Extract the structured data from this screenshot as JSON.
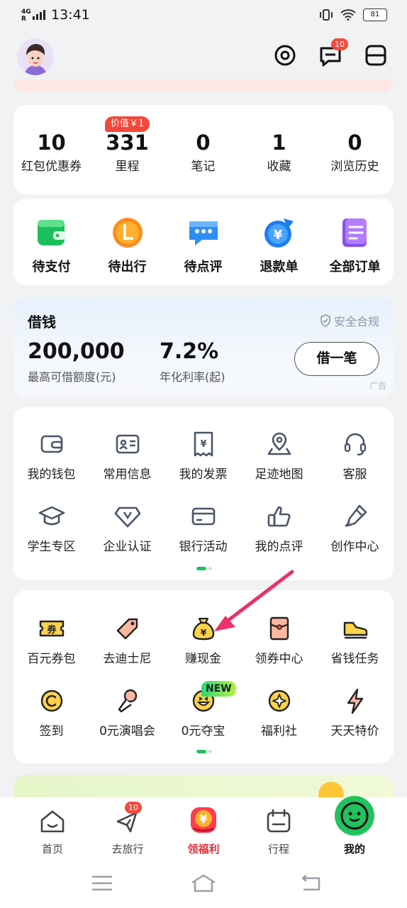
{
  "status": {
    "network": "4G",
    "roaming": "R",
    "time": "13:41",
    "battery": "81"
  },
  "header": {
    "messages_badge": "10"
  },
  "stats": [
    {
      "value": "10",
      "label": "红包优惠券"
    },
    {
      "value": "331",
      "label": "里程",
      "tag": "价值￥1"
    },
    {
      "value": "0",
      "label": "笔记"
    },
    {
      "value": "1",
      "label": "收藏"
    },
    {
      "value": "0",
      "label": "浏览历史"
    }
  ],
  "orders": [
    {
      "label": "待支付",
      "icon": "wallet-icon"
    },
    {
      "label": "待出行",
      "icon": "coin-l-icon"
    },
    {
      "label": "待点评",
      "icon": "chat-bubble-icon"
    },
    {
      "label": "退款单",
      "icon": "refund-icon"
    },
    {
      "label": "全部订单",
      "icon": "list-doc-icon"
    }
  ],
  "loan": {
    "title": "借钱",
    "compliance": "安全合规",
    "amount": "200,000",
    "amount_label": "最高可借额度(元)",
    "rate": "7.2%",
    "rate_label": "年化利率(起)",
    "button": "借一笔",
    "ad": "广告"
  },
  "tools": [
    {
      "label": "我的钱包",
      "icon": "wallet-outline-icon"
    },
    {
      "label": "常用信息",
      "icon": "id-card-icon"
    },
    {
      "label": "我的发票",
      "icon": "invoice-icon"
    },
    {
      "label": "足迹地图",
      "icon": "map-pin-icon"
    },
    {
      "label": "客服",
      "icon": "headset-icon"
    },
    {
      "label": "学生专区",
      "icon": "grad-cap-icon"
    },
    {
      "label": "企业认证",
      "icon": "diamond-icon"
    },
    {
      "label": "银行活动",
      "icon": "bank-card-icon"
    },
    {
      "label": "我的点评",
      "icon": "thumbs-up-icon"
    },
    {
      "label": "创作中心",
      "icon": "pen-icon"
    }
  ],
  "welfare": [
    {
      "label": "百元券包",
      "icon": "coupon-ticket-icon"
    },
    {
      "label": "去迪士尼",
      "icon": "tag-icon"
    },
    {
      "label": "赚现金",
      "icon": "money-bag-icon"
    },
    {
      "label": "领券中心",
      "icon": "red-envelope-icon"
    },
    {
      "label": "省钱任务",
      "icon": "shoe-icon"
    },
    {
      "label": "签到",
      "icon": "c-coin-icon"
    },
    {
      "label": "0元演唱会",
      "icon": "microphone-icon"
    },
    {
      "label": "0元夺宝",
      "icon": "smiley-icon",
      "tag": "NEW"
    },
    {
      "label": "福利社",
      "icon": "sparkle-coin-icon"
    },
    {
      "label": "天天特价",
      "icon": "lightning-icon"
    }
  ],
  "tabs": [
    {
      "label": "首页",
      "icon": "home-icon"
    },
    {
      "label": "去旅行",
      "icon": "plane-icon",
      "badge": "10"
    },
    {
      "label": "领福利",
      "icon": "red-packet-icon"
    },
    {
      "label": "行程",
      "icon": "calendar-icon"
    },
    {
      "label": "我的",
      "icon": "face-icon"
    }
  ],
  "colors": {
    "accent_green": "#22c25f",
    "red": "#f3473a",
    "brand_orange": "#ff8a1c"
  }
}
